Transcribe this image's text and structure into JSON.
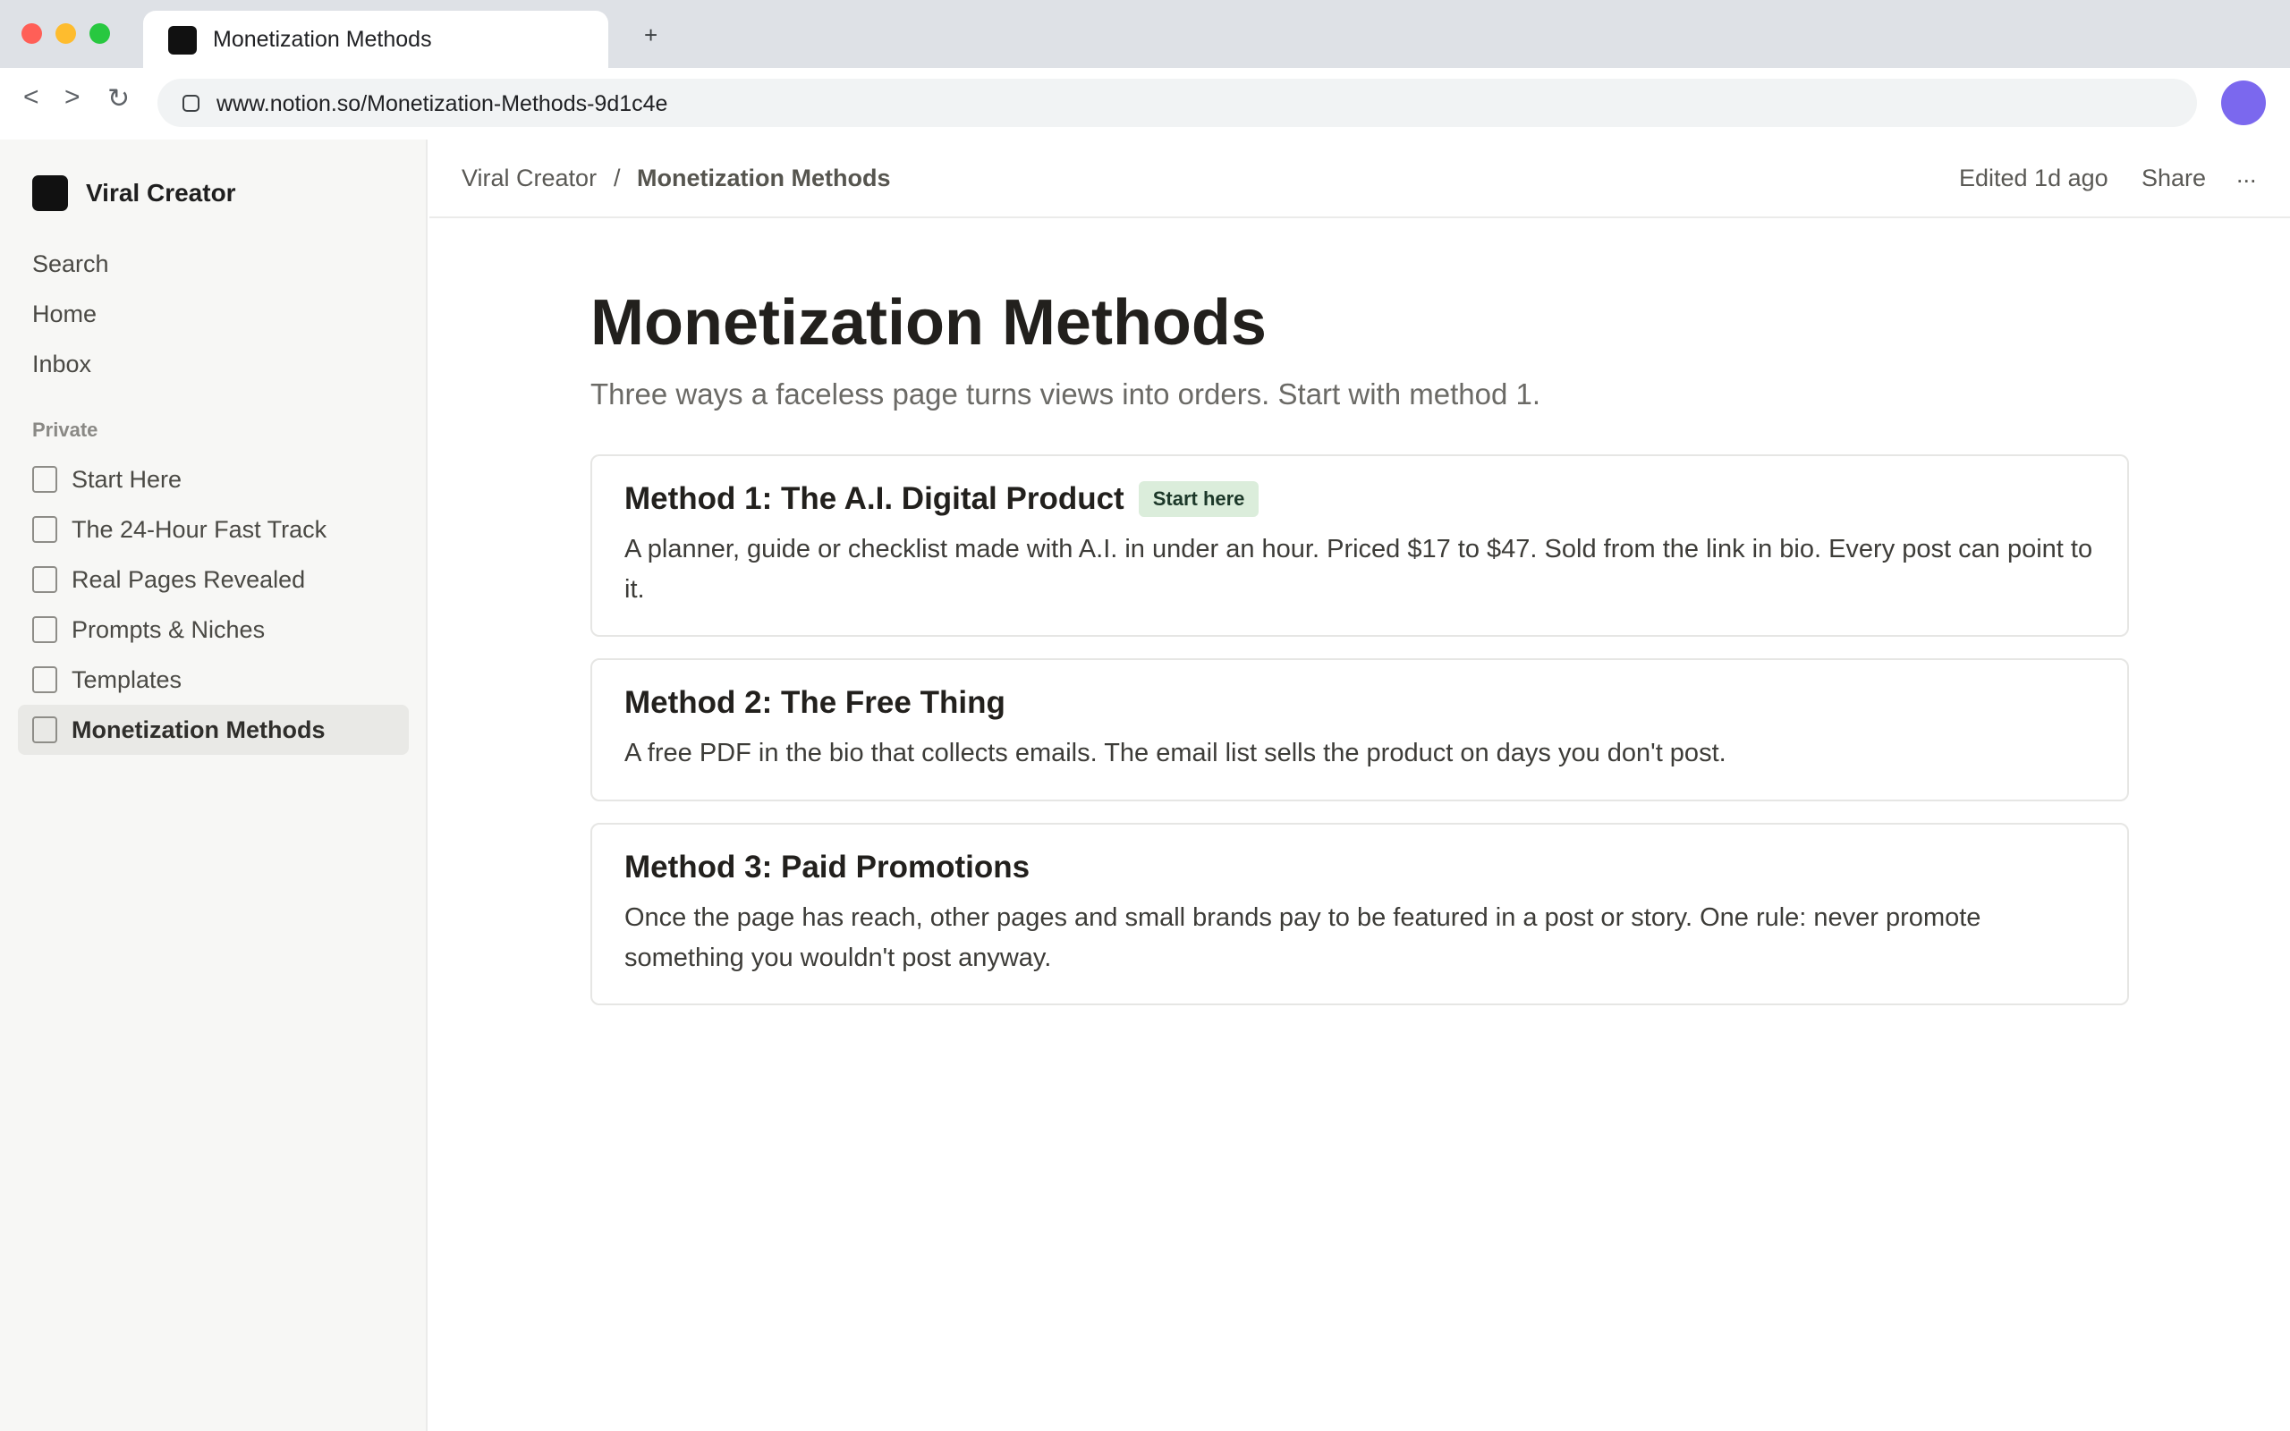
{
  "browser": {
    "tab_title": "Monetization Methods",
    "new_tab_label": "+",
    "back_label": "<",
    "forward_label": ">",
    "reload_label": "↻",
    "url": "www.notion.so/Monetization-Methods-9d1c4e",
    "profile_color": "#7b68ee",
    "icons": [
      "close-window-icon",
      "minimize-window-icon",
      "maximize-window-icon",
      "site-info-icon",
      "profile-avatar-icon"
    ]
  },
  "sidebar": {
    "workspace_name": "Viral Creator",
    "nav": [
      {
        "label": "Search"
      },
      {
        "label": "Home"
      },
      {
        "label": "Inbox"
      }
    ],
    "section_label": "Private",
    "pages": [
      {
        "label": "Start Here",
        "active": false
      },
      {
        "label": "The 24-Hour Fast Track",
        "active": false
      },
      {
        "label": "Real Pages Revealed",
        "active": false
      },
      {
        "label": "Prompts & Niches",
        "active": false
      },
      {
        "label": "Templates",
        "active": false
      },
      {
        "label": "Monetization Methods",
        "active": true
      }
    ]
  },
  "topbar": {
    "breadcrumb": [
      "Viral Creator",
      "Monetization Methods"
    ],
    "breadcrumb_separator": "/",
    "edited": "Edited 1d ago",
    "share_label": "Share",
    "more_label": "..."
  },
  "page": {
    "title": "Monetization Methods",
    "subtitle": "Three ways a faceless page turns views into orders. Start with method 1.",
    "cards": [
      {
        "title": "Method 1: The A.I. Digital Product",
        "badge": "Start here",
        "body": "A planner, guide or checklist made with A.I. in under an hour. Priced $17 to $47. Sold from the link in bio. Every post can point to it."
      },
      {
        "title": "Method 2: The Free Thing",
        "body": "A free PDF in the bio that collects emails. The email list sells the product on days you don't post."
      },
      {
        "title": "Method 3: Paid Promotions",
        "body": "Once the page has reach, other pages and small brands pay to be featured in a post or story. One rule: never promote something you wouldn't post anyway."
      }
    ],
    "badge_color": "#dbeddb"
  }
}
